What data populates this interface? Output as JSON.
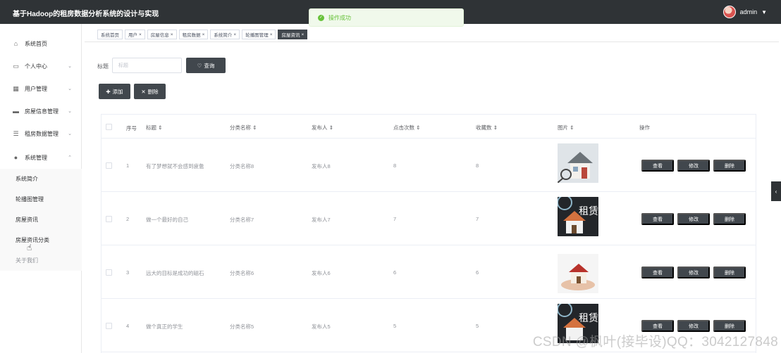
{
  "header": {
    "title": "基于Hadoop的租房数据分析系统的设计与实现",
    "user": "admin"
  },
  "toast": {
    "message": "操作成功"
  },
  "sidebar": {
    "items": [
      {
        "label": "系统首页",
        "icon": "home-icon"
      },
      {
        "label": "个人中心",
        "icon": "user-card-icon"
      },
      {
        "label": "用户管理",
        "icon": "grid-icon"
      },
      {
        "label": "房屋信息管理",
        "icon": "monitor-icon"
      },
      {
        "label": "租房数据管理",
        "icon": "sliders-icon"
      },
      {
        "label": "系统管理",
        "icon": "location-icon"
      }
    ],
    "submenu": [
      "系统简介",
      "轮播图管理",
      "房屋资讯",
      "房屋资讯分类",
      "关于我们"
    ]
  },
  "tabs": [
    "系统首页",
    "用户",
    "房屋信息",
    "租房数据",
    "系统简介",
    "轮播图管理",
    "房屋资讯"
  ],
  "search": {
    "label": "标题",
    "placeholder": "标题",
    "button": "查询"
  },
  "toolbar": {
    "add": "添加",
    "delete": "删除"
  },
  "table": {
    "headers": {
      "index": "序号",
      "title": "标题",
      "category": "分类名称",
      "publisher": "发布人",
      "clicks": "点击次数",
      "favorites": "收藏数",
      "image": "图片",
      "actions": "操作"
    },
    "rows": [
      {
        "index": "1",
        "title": "有了梦想就不会感到疲惫",
        "category": "分类名称8",
        "publisher": "发布人8",
        "clicks": "8",
        "favorites": "8",
        "image": "house-key-photo"
      },
      {
        "index": "2",
        "title": "做一个最好的自己",
        "category": "分类名称7",
        "publisher": "发布人7",
        "clicks": "7",
        "favorites": "7",
        "image": "rent-banner-photo",
        "image_text": "租赁"
      },
      {
        "index": "3",
        "title": "远大的目标是成功的磁石",
        "category": "分类名称6",
        "publisher": "发布人6",
        "clicks": "6",
        "favorites": "6",
        "image": "house-hands-photo"
      },
      {
        "index": "4",
        "title": "做个真正的学生",
        "category": "分类名称5",
        "publisher": "发布人5",
        "clicks": "5",
        "favorites": "5",
        "image": "rent-banner-photo",
        "image_text": "租赁"
      }
    ],
    "actions": {
      "view": "查看",
      "edit": "修改",
      "delete": "删除"
    }
  },
  "watermark": "CSDN @枫叶(接毕设)QQ：3042127848"
}
